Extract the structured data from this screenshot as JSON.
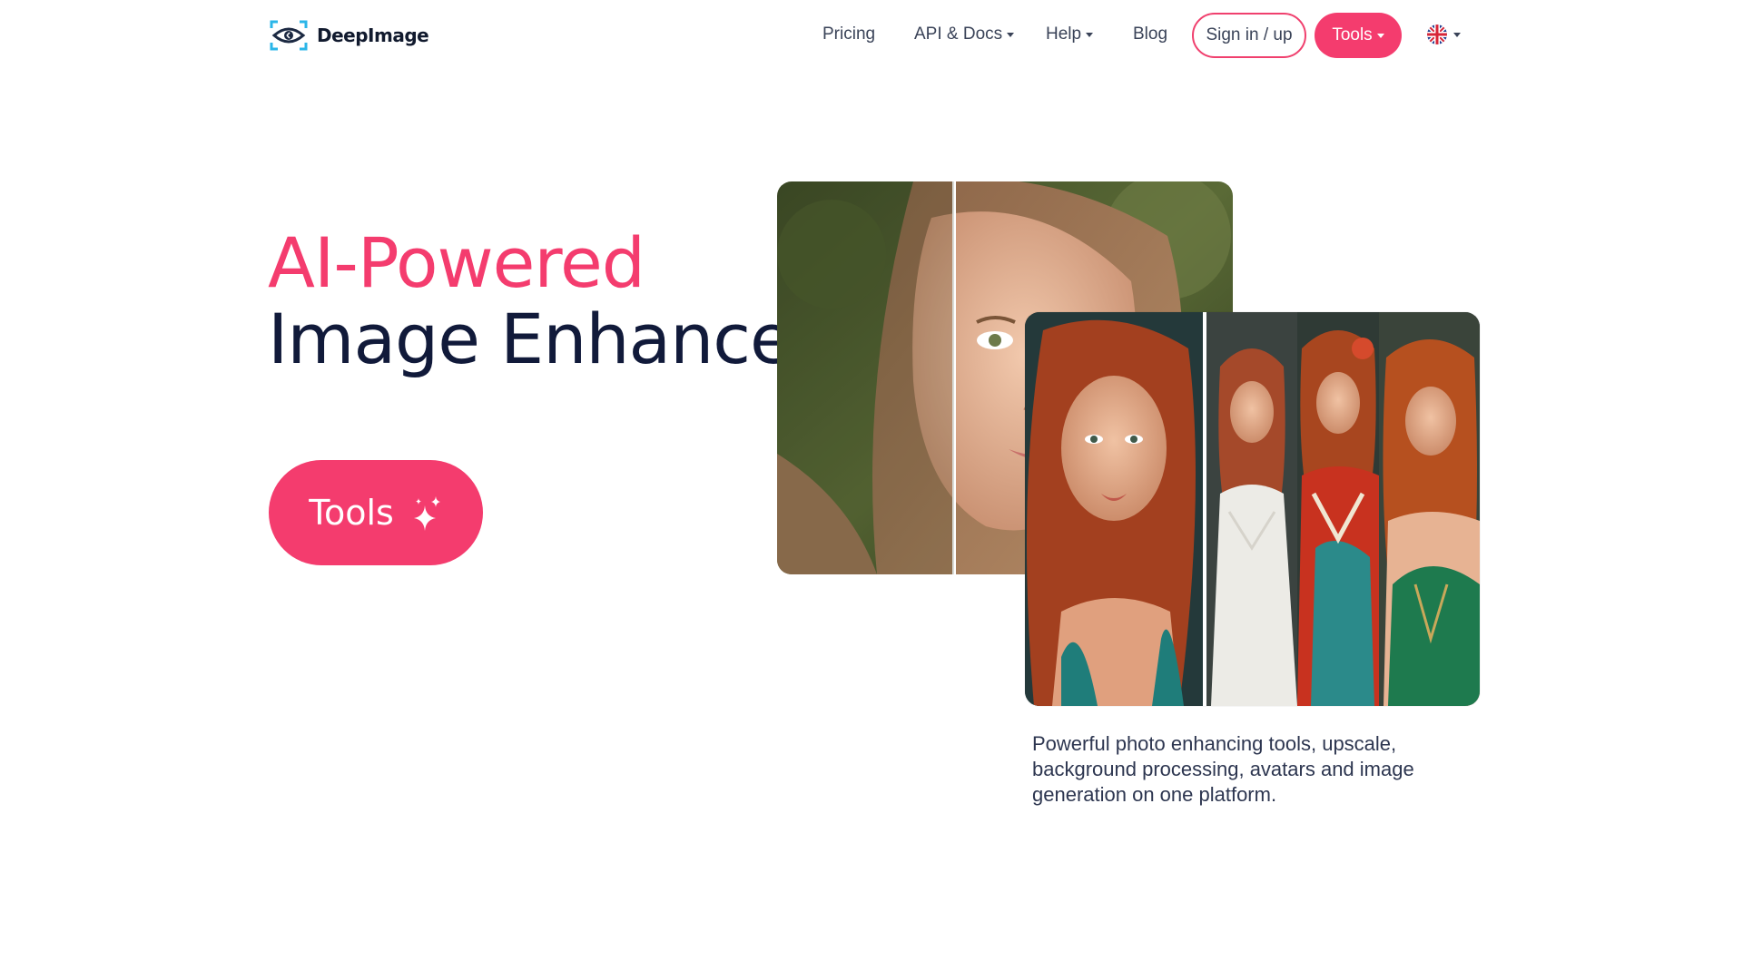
{
  "brand": {
    "name": "DeepImage",
    "logo_icon": "eye-logo-icon"
  },
  "nav": {
    "items": [
      {
        "label": "Pricing",
        "dropdown": false
      },
      {
        "label": "API & Docs",
        "dropdown": true
      },
      {
        "label": "Help",
        "dropdown": true
      },
      {
        "label": "Blog",
        "dropdown": false
      }
    ],
    "signin_label": "Sign in / up",
    "tools_label": "Tools",
    "language_icon": "uk-flag-icon"
  },
  "hero": {
    "title_line1": "AI-Powered",
    "title_line2": "Image Enhancer",
    "button_label": "Tools",
    "button_icon": "sparkle-icon"
  },
  "images": [
    {
      "name": "before-after-portrait"
    },
    {
      "name": "avatar-collage"
    }
  ],
  "description": "Powerful photo enhancing tools, upscale, background processing, avatars and image generation on one platform.",
  "colors": {
    "accent": "#f43c6e",
    "heading": "#111a3a",
    "text": "#3a4358"
  }
}
